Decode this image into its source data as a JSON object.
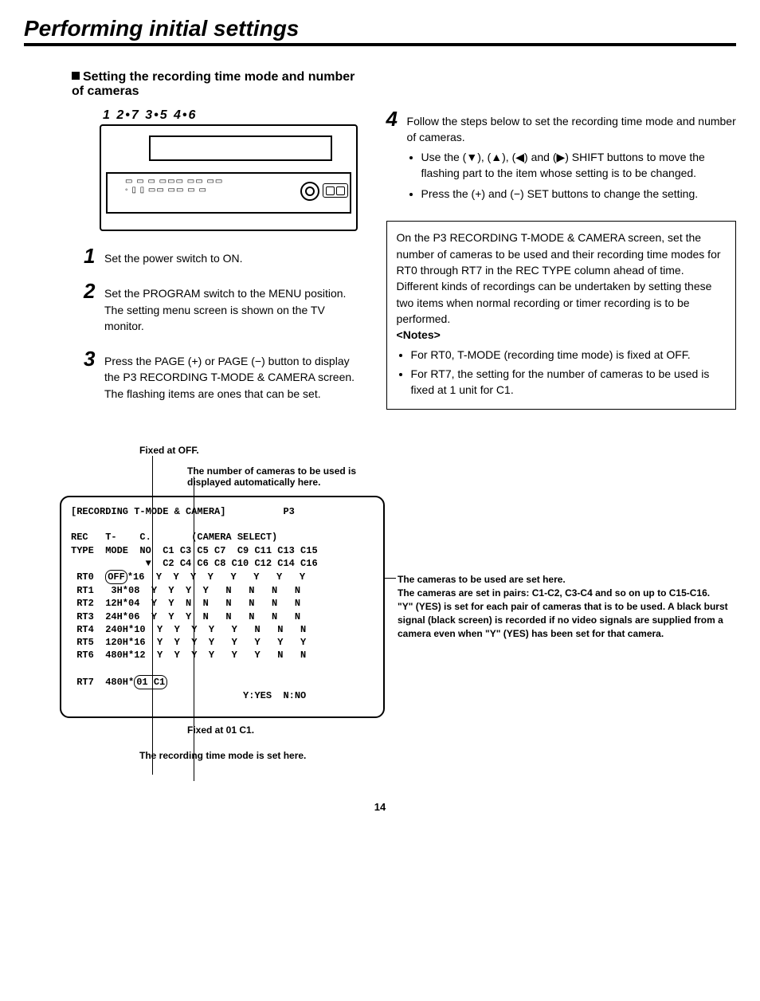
{
  "page_title": "Performing initial settings",
  "section_heading": "Setting the recording time mode and number of cameras",
  "diagram_labels": "1   2•7   3•5   4•6",
  "steps": [
    {
      "num": "1",
      "text": "Set the power switch to ON."
    },
    {
      "num": "2",
      "text": "Set the PROGRAM switch to the MENU position. The setting menu screen is shown on the TV monitor."
    },
    {
      "num": "3",
      "text": "Press the PAGE (+) or PAGE (−) button to display the P3 RECORDING T-MODE & CAMERA screen. The flashing items are ones that can be set."
    },
    {
      "num": "4",
      "text": "Follow the steps below to set the recording time mode and number of cameras.",
      "bullets": [
        "Use the (▼), (▲), (◀) and (▶) SHIFT buttons to move the flashing part to the item whose setting is to be changed.",
        "Press the (+) and (−) SET buttons to change the setting."
      ]
    }
  ],
  "info_box": {
    "para1": "On the P3 RECORDING T-MODE & CAMERA screen, set the number of cameras to be used and their recording time modes for RT0 through RT7 in the REC TYPE column ahead of time.",
    "para2": "Different kinds of recordings can be undertaken by setting these two items when normal recording or timer recording is to be performed.",
    "notes_label": "<Notes>",
    "notes": [
      "For RT0, T-MODE (recording time mode) is fixed at OFF.",
      "For RT7, the setting for the number of cameras to be used is fixed at 1 unit for C1."
    ]
  },
  "callouts": {
    "top1": "Fixed at OFF.",
    "top2": "The number of cameras to be used is displayed automatically here.",
    "right1": "The cameras to be used are set here.",
    "right2": "The cameras are set in pairs: C1-C2, C3-C4 and so on up to C15-C16.",
    "right3": "\"Y\" (YES) is set for each pair of cameras that is to be used. A black burst signal (black screen) is recorded if no video signals are supplied from a camera even when \"Y\" (YES) has been set for that camera.",
    "bot1": "Fixed at 01 C1.",
    "bot2": "The recording time mode is set here."
  },
  "screen": {
    "title": "[RECORDING T-MODE & CAMERA]          P3",
    "header1": "REC   T-    C.       (CAMERA SELECT)",
    "header2": "TYPE  MODE  NO  C1 C3 C5 C7  C9 C11 C13 C15",
    "header3": "             ▼  C2 C4 C6 C8 C10 C12 C14 C16",
    "rows": [
      {
        "type": "RT0",
        "mode": "OFF",
        "no": "*16",
        "cams": " Y  Y  Y  Y   Y   Y   Y   Y",
        "boxed_mode": true
      },
      {
        "type": "RT1",
        "mode": " 3H",
        "no": "*08",
        "cams": " Y  Y  Y  Y   N   N   N   N"
      },
      {
        "type": "RT2",
        "mode": "12H",
        "no": "*04",
        "cams": " Y  Y  N  N   N   N   N   N"
      },
      {
        "type": "RT3",
        "mode": "24H",
        "no": "*06",
        "cams": " Y  Y  Y  N   N   N   N   N"
      },
      {
        "type": "RT4",
        "mode": "240H",
        "no": "*10",
        "cams": " Y  Y  Y  Y   Y   N   N   N"
      },
      {
        "type": "RT5",
        "mode": "120H",
        "no": "*16",
        "cams": " Y  Y  Y  Y   Y   Y   Y   Y"
      },
      {
        "type": "RT6",
        "mode": "480H",
        "no": "*12",
        "cams": " Y  Y  Y  Y   Y   Y   N   N"
      }
    ],
    "rt7": {
      "type": "RT7",
      "mode": "480H",
      "tail": "01 C1",
      "boxed_tail": true
    },
    "legend": "Y:YES  N:NO"
  },
  "page_number": "14"
}
